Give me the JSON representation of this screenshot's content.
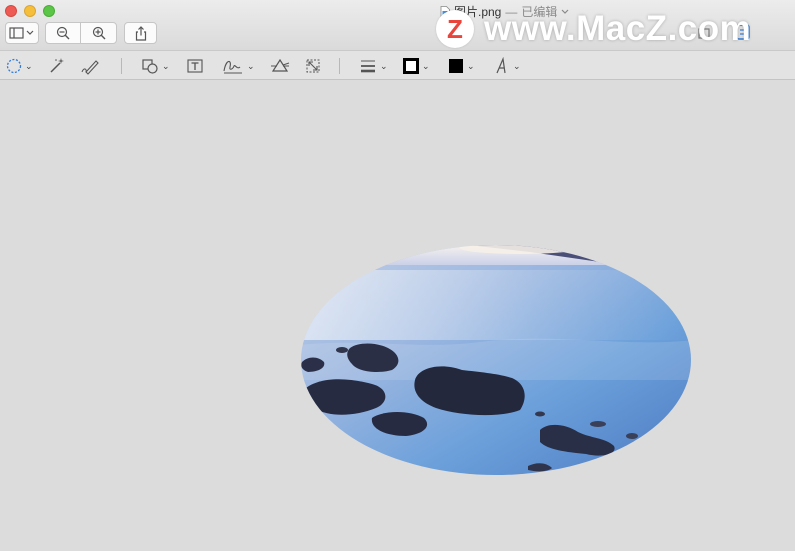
{
  "window": {
    "title": "图片.png",
    "separator": "—",
    "status": "已编辑"
  },
  "toolbar": {
    "sidebar": "sidebar-icon",
    "zoom_out": "zoom-out-icon",
    "zoom_in": "zoom-in-icon",
    "share": "share-icon"
  },
  "markup_tools": [
    "selection-tool",
    "instant-alpha",
    "sketch",
    "shapes",
    "text",
    "sign",
    "adjust-color",
    "adjust-size",
    "shape-style",
    "border-color",
    "fill-color",
    "text-style"
  ],
  "watermark": {
    "logo_letter": "Z",
    "text": "www.MacZ.com"
  },
  "colors": {
    "window_bg": "#dcdcdc",
    "selection_accent": "#2f7bd8",
    "watermark_logo": "#e8453c"
  }
}
